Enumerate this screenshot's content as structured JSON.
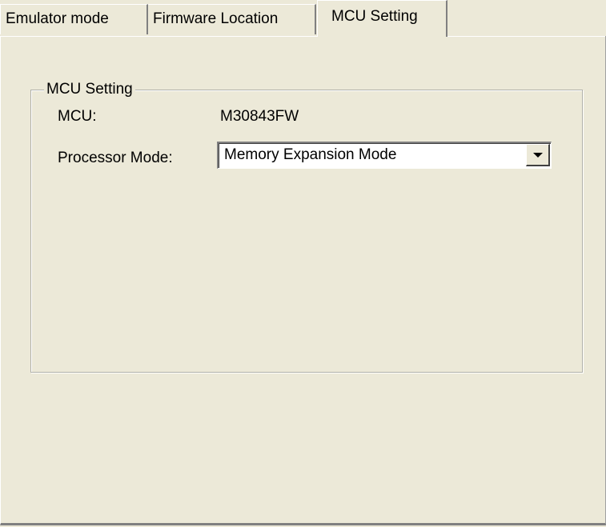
{
  "tabs": [
    {
      "label": "Emulator mode",
      "active": false
    },
    {
      "label": "Firmware Location",
      "active": false
    },
    {
      "label": "MCU Setting",
      "active": true
    }
  ],
  "mcu_group": {
    "title": "MCU Setting",
    "mcu_label": "MCU:",
    "mcu_value": "M30843FW",
    "processor_mode_label": "Processor Mode:",
    "processor_mode_value": "Memory Expansion Mode"
  },
  "colors": {
    "window_background": "#ece9d8",
    "field_background": "#ffffff"
  },
  "icons": {
    "dropdown": "chevron-down-icon"
  }
}
